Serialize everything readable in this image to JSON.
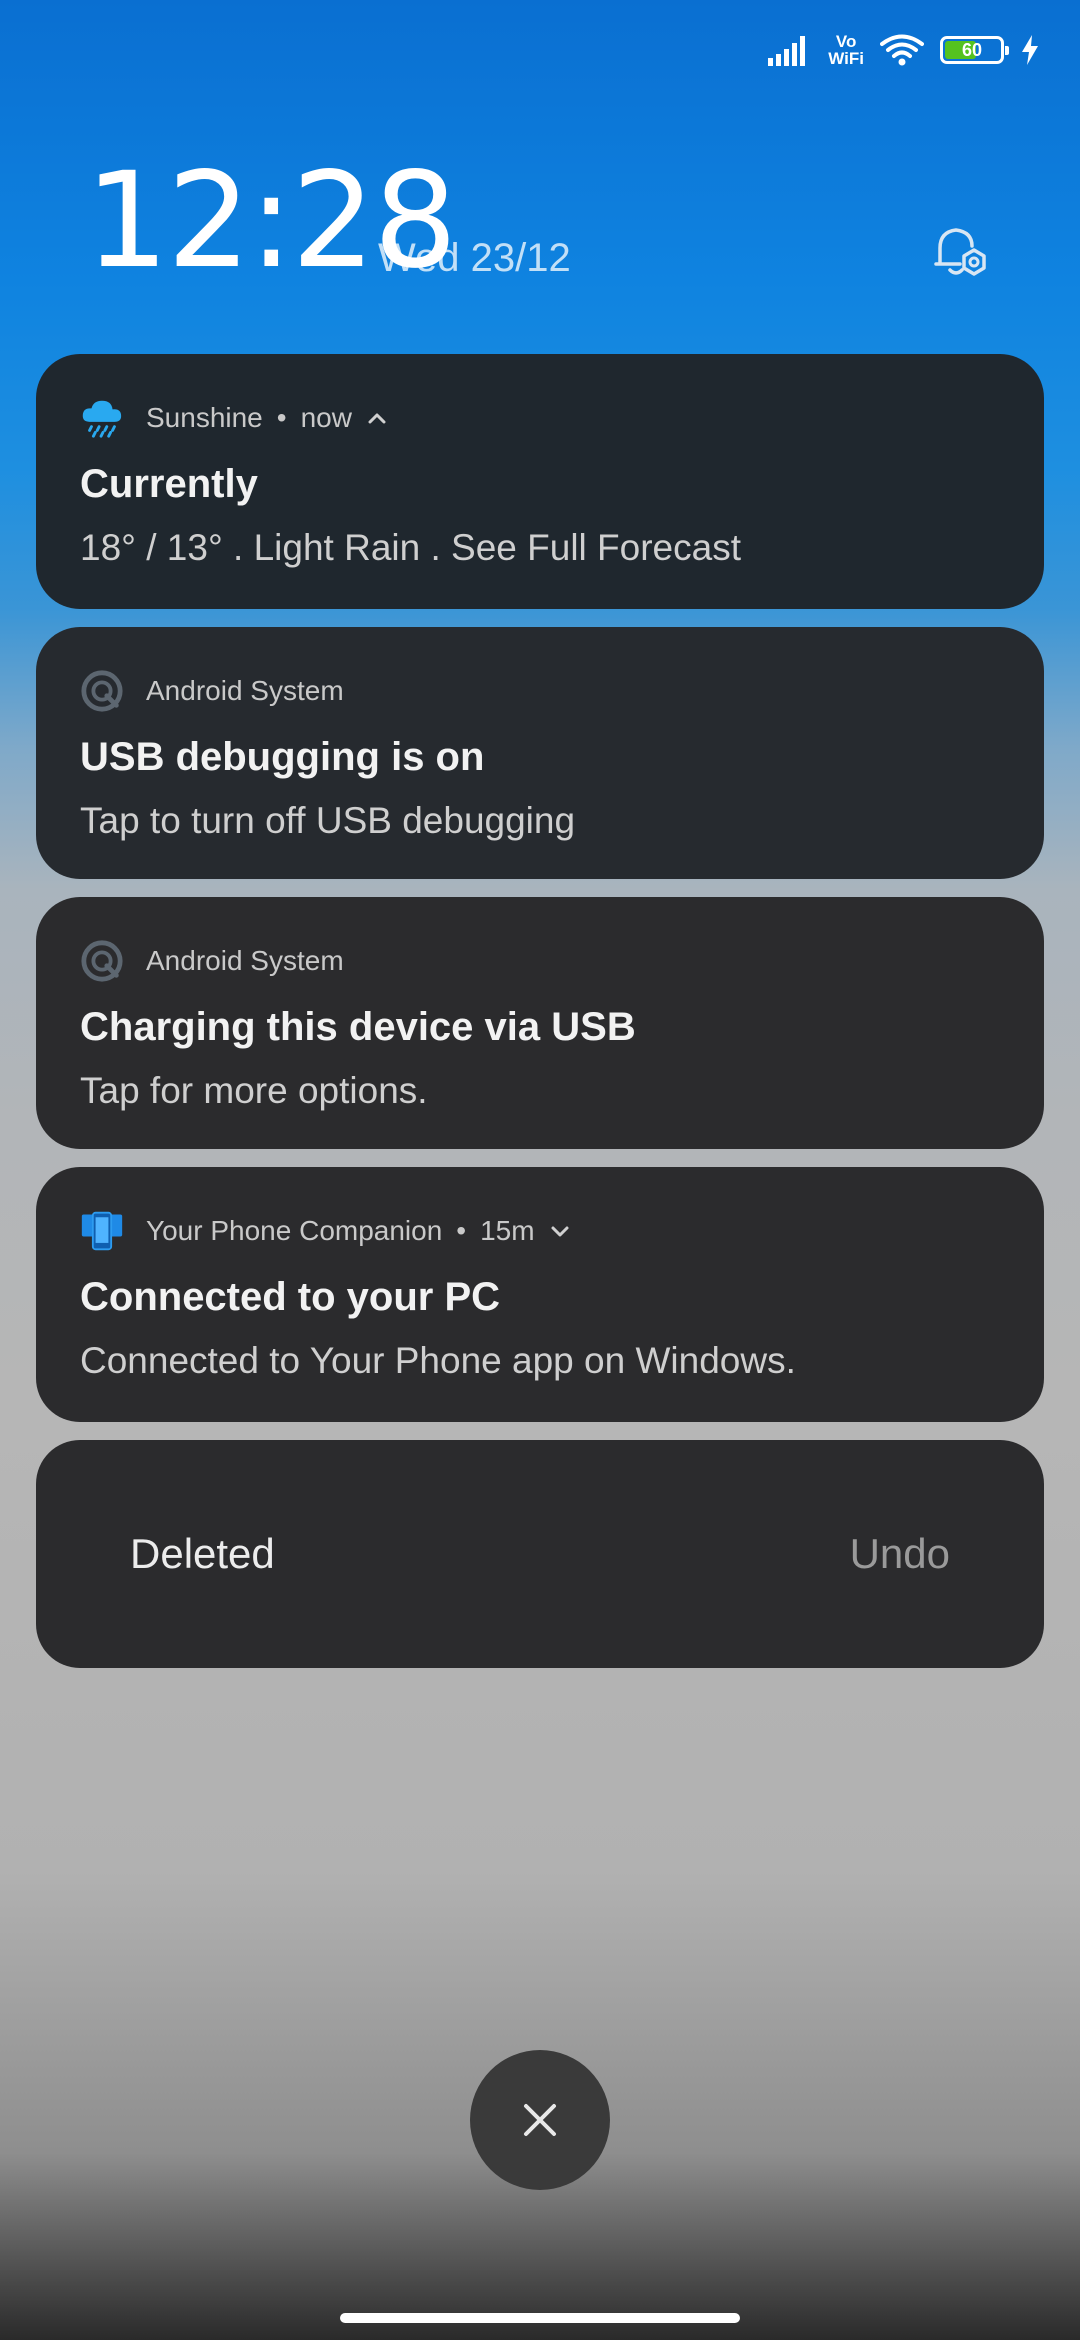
{
  "status_bar": {
    "volte_top": "Vo",
    "volte_bottom": "WiFi",
    "battery_level": "60",
    "battery_fraction": 0.6
  },
  "lockscreen": {
    "time": "12:28",
    "date": "Wed 23/12"
  },
  "notifications": [
    {
      "app_name": "Sunshine",
      "time": "now",
      "title": "Currently",
      "body": "18° / 13° . Light Rain . See Full Forecast",
      "icon": "rain-cloud-icon"
    },
    {
      "app_name": "Android System",
      "title": "USB debugging is on",
      "body": "Tap to turn off USB debugging",
      "icon": "android-system-icon"
    },
    {
      "app_name": "Android System",
      "title": "Charging this device via USB",
      "body": "Tap for more options.",
      "icon": "android-system-icon"
    },
    {
      "app_name": "Your Phone Companion",
      "time": "15m",
      "title": "Connected to your PC",
      "body": "Connected to Your Phone app on Windows.",
      "icon": "your-phone-icon"
    }
  ],
  "deleted_card": {
    "text": "Deleted",
    "undo_label": "Undo"
  },
  "colors": {
    "accent_blue": "#1e8fe0",
    "weather_icon": "#29a9f0",
    "your_phone_icon": "#1f8ae6",
    "battery_green": "#55c21f"
  }
}
